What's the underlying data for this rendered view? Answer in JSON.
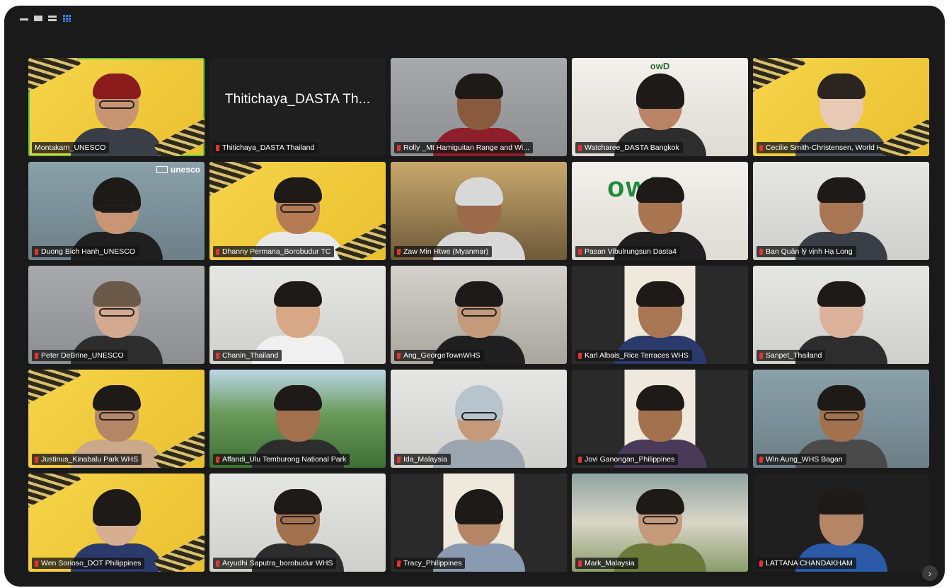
{
  "view_controls": [
    {
      "name": "minimize",
      "icon": "minimize-icon"
    },
    {
      "name": "speaker-view",
      "icon": "speaker-view-icon"
    },
    {
      "name": "strip-view",
      "icon": "strip-view-icon"
    },
    {
      "name": "gallery-view",
      "icon": "gallery-view-icon",
      "active": true
    }
  ],
  "participants": [
    {
      "label": "Montakarn_UNESCO",
      "muted": false,
      "active_speaker": true
    },
    {
      "label": "Thitichaya_DASTA Thailand",
      "display_name": "Thitichaya_DASTA Th...",
      "muted": true,
      "video": false
    },
    {
      "label": "Rolly _Mt Hamiguitan Range and Wi...",
      "muted": true
    },
    {
      "label": "Watcharee_DASTA Bangkok",
      "muted": true,
      "logo": "owd"
    },
    {
      "label": "Cecilie Smith-Christensen, World H...",
      "muted": true
    },
    {
      "label": "Duong Bich Hanh_UNESCO",
      "muted": true,
      "logo": "unesco"
    },
    {
      "label": "Dhanny Permana_Borobudur TC",
      "muted": true
    },
    {
      "label": "Zaw Min Htwe (Myanmar)",
      "muted": true
    },
    {
      "label": "Pasan Vibulrungsun Dasta4",
      "muted": true
    },
    {
      "label": "Ban Quản lý vịnh Hạ Long",
      "muted": true
    },
    {
      "label": "Peter DeBrine_UNESCO",
      "muted": true
    },
    {
      "label": "Chanin_Thailand",
      "muted": true
    },
    {
      "label": "Ang_GeorgeTownWHS",
      "muted": true
    },
    {
      "label": "Karl Albais_Rice Terraces WHS",
      "muted": true
    },
    {
      "label": "Sanpet_Thailand",
      "muted": true
    },
    {
      "label": "Justinus_Kinabalu Park WHS",
      "muted": true
    },
    {
      "label": "Affandi_Ulu Temburong National Park",
      "muted": true
    },
    {
      "label": "Ida_Malaysia",
      "muted": true
    },
    {
      "label": "Jovi Ganongan_Philippines",
      "muted": true
    },
    {
      "label": "Win Aung_WHS Bagan",
      "muted": true
    },
    {
      "label": "Wen Sorioso_DOT Philippines",
      "muted": true
    },
    {
      "label": "Aryudhi Saputra_borobudur WHS",
      "muted": true
    },
    {
      "label": "Tracy_Philippines",
      "muted": true
    },
    {
      "label": "Mark_Malaysia",
      "muted": true
    },
    {
      "label": "LATTANA CHANDAKHAM",
      "muted": true
    }
  ],
  "logos": {
    "unesco": "unesco",
    "owd": "owD"
  },
  "next_page_icon": "chevron-right-icon",
  "next_page_glyph": "›"
}
